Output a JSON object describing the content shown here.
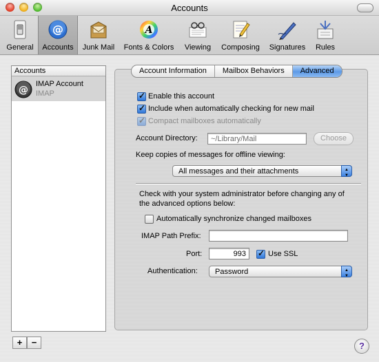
{
  "window": {
    "title": "Accounts"
  },
  "toolbar": {
    "items": [
      {
        "label": "General",
        "icon": "light-switch-icon"
      },
      {
        "label": "Accounts",
        "icon": "at-sign-icon"
      },
      {
        "label": "Junk Mail",
        "icon": "junk-mail-icon"
      },
      {
        "label": "Fonts & Colors",
        "icon": "color-wheel-font-icon"
      },
      {
        "label": "Viewing",
        "icon": "glasses-viewing-icon"
      },
      {
        "label": "Composing",
        "icon": "pencil-paper-icon"
      },
      {
        "label": "Signatures",
        "icon": "pen-signature-icon"
      },
      {
        "label": "Rules",
        "icon": "rules-icon"
      }
    ],
    "selected": "Accounts"
  },
  "accounts": {
    "header": "Accounts",
    "items": [
      {
        "name": "IMAP Account",
        "type": "IMAP"
      }
    ],
    "add_label": "+",
    "remove_label": "−"
  },
  "tabs": {
    "items": [
      "Account Information",
      "Mailbox Behaviors",
      "Advanced"
    ],
    "selected": "Advanced"
  },
  "advanced": {
    "enable_account": {
      "label": "Enable this account",
      "checked": true
    },
    "include_check": {
      "label": "Include when automatically checking for new mail",
      "checked": true
    },
    "compact": {
      "label": "Compact mailboxes automatically",
      "checked": true,
      "disabled": true
    },
    "account_directory": {
      "label": "Account Directory:",
      "value": "~/Library/Mail",
      "button": "Choose"
    },
    "keep_copies": {
      "label": "Keep copies of messages for offline viewing:",
      "value": "All messages and their attachments"
    },
    "admin_note": {
      "line1": "Check with your system administrator before changing any of",
      "line2": "the advanced options below:"
    },
    "auto_sync": {
      "label": "Automatically synchronize changed mailboxes",
      "checked": false
    },
    "imap_prefix": {
      "label": "IMAP Path Prefix:",
      "value": ""
    },
    "port": {
      "label": "Port:",
      "value": "993"
    },
    "use_ssl": {
      "label": "Use SSL",
      "checked": true
    },
    "authentication": {
      "label": "Authentication:",
      "value": "Password"
    }
  },
  "help": {
    "label": "?"
  },
  "colors": {
    "selection_blue": "#5d9ae6",
    "checkbox_blue": "#2f76d8"
  }
}
